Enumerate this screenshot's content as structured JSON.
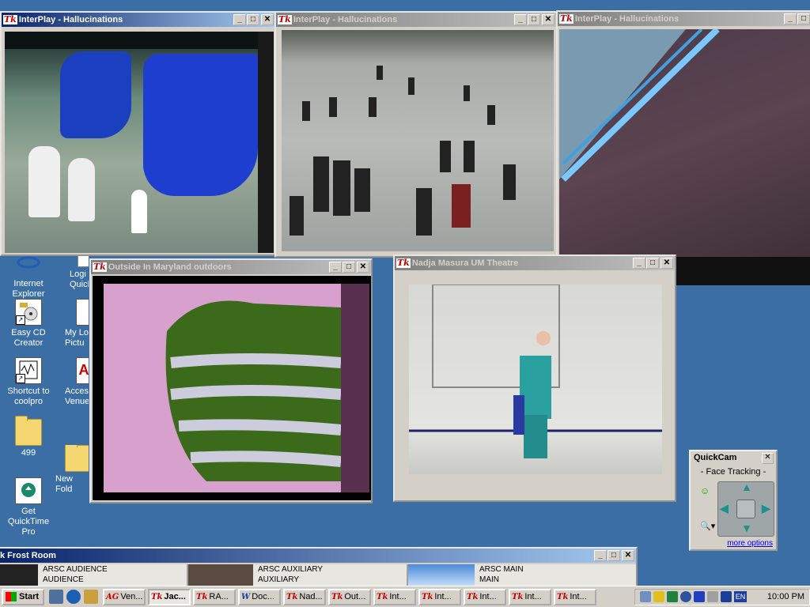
{
  "desktop_icons": [
    {
      "label": "Internet Explorer",
      "icon": "ie-icon"
    },
    {
      "label": "Logi Quick",
      "icon": "logitech-icon"
    },
    {
      "label": "Easy CD Creator",
      "icon": "cd-creator-icon"
    },
    {
      "label": "My Lo Pictu",
      "icon": "pictures-icon"
    },
    {
      "label": "Shortcut to coolpro",
      "icon": "coolpro-icon"
    },
    {
      "label": "Acces Venue",
      "icon": "access-icon"
    },
    {
      "label": "499",
      "icon": "folder-icon"
    },
    {
      "label": "New Fold",
      "icon": "folder-icon"
    },
    {
      "label": "Get QuickTime Pro",
      "icon": "quicktime-icon"
    }
  ],
  "windows": {
    "w1": {
      "icon": "Tk",
      "title": "InterPlay - Hallucinations"
    },
    "w2": {
      "icon": "Tk",
      "title": "InterPlay - Hallucinations"
    },
    "w3": {
      "icon": "Tk",
      "title": "InterPlay - Hallucinations"
    },
    "w4": {
      "icon": "Tk",
      "title": "Outside In Maryland outdoors"
    },
    "w5": {
      "icon": "Tk",
      "title": "Nadja Masura UM Theatre"
    },
    "w6": {
      "title": "k Frost Room"
    }
  },
  "frost_room": {
    "panes": [
      {
        "line1": "ARSC AUDIENCE",
        "line2": "AUDIENCE"
      },
      {
        "line1": "ARSC AUXILIARY",
        "line2": "AUXILIARY"
      },
      {
        "line1": "ARSC MAIN",
        "line2": "MAIN"
      }
    ]
  },
  "quickcam": {
    "title": "QuickCam",
    "mode": "- Face Tracking -",
    "more_options": "more options"
  },
  "taskbar": {
    "start_label": "Start",
    "tasks": [
      {
        "icon": "AG",
        "label": "Ven..."
      },
      {
        "icon": "Tk",
        "label": "Jac...",
        "active": true
      },
      {
        "icon": "Tk",
        "label": "RA..."
      },
      {
        "icon": "W",
        "label": "Doc..."
      },
      {
        "icon": "Tk",
        "label": "Nad..."
      },
      {
        "icon": "Tk",
        "label": "Out..."
      },
      {
        "icon": "Tk",
        "label": "Int..."
      },
      {
        "icon": "Tk",
        "label": "Int..."
      },
      {
        "icon": "Tk",
        "label": "Int..."
      },
      {
        "icon": "Tk",
        "label": "Int..."
      },
      {
        "icon": "Tk",
        "label": "Int..."
      }
    ],
    "tray_lang": "EN",
    "clock": "10:00 PM"
  }
}
